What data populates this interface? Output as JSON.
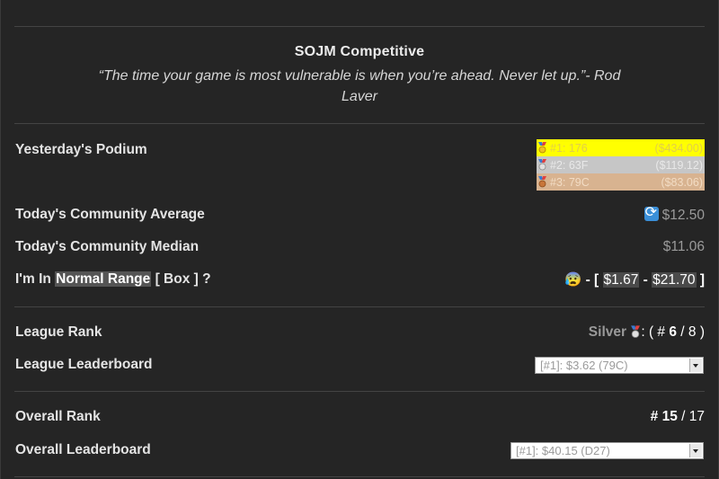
{
  "header": {
    "title": "SOJM Competitive",
    "quote": "“The time your game is most vulnerable is when you’re ahead. Never let up.”- Rod Laver"
  },
  "podium": {
    "label": "Yesterday's Podium",
    "entries": [
      {
        "rank": "#1: 176",
        "amount": "($434.00)"
      },
      {
        "rank": "#2: 63F",
        "amount": "($119.12)"
      },
      {
        "rank": "#3: 79C",
        "amount": "($83.06)"
      }
    ]
  },
  "average": {
    "label": "Today's Community Average",
    "value": "$12.50"
  },
  "median": {
    "label": "Today's Community Median",
    "value": "$11.06"
  },
  "normal_range": {
    "label_prefix": "I'm In ",
    "label_highlight": "Normal Range",
    "label_suffix": " [ Box ] ?",
    "open": "- [ ",
    "low": "$1.67",
    "dash": " - ",
    "high": "$21.70",
    "close": " ]",
    "emoji": "😰"
  },
  "league": {
    "rank_label": "League Rank",
    "tier": "Silver",
    "rank_open": ": ( # ",
    "rank": "6",
    "rank_sep": " / ",
    "total": "8",
    "rank_close": " )",
    "leaderboard_label": "League Leaderboard",
    "leaderboard_selected": "[#1]: $3.62 (79C)"
  },
  "overall": {
    "rank_label": "Overall Rank",
    "rank_prefix": "# ",
    "rank": "15",
    "rank_sep": " / ",
    "total": "17",
    "leaderboard_label": "Overall Leaderboard",
    "leaderboard_selected": "[#1]: $40.15 (D27)"
  },
  "colors": {
    "gold": "#ffff00",
    "silver": "#c6c6c6",
    "bronze": "#d8b390",
    "refresh": "#3a8fd8"
  },
  "icons": {
    "medal": "medal-icon",
    "refresh": "refresh-icon",
    "worried": "worried-face-icon"
  }
}
